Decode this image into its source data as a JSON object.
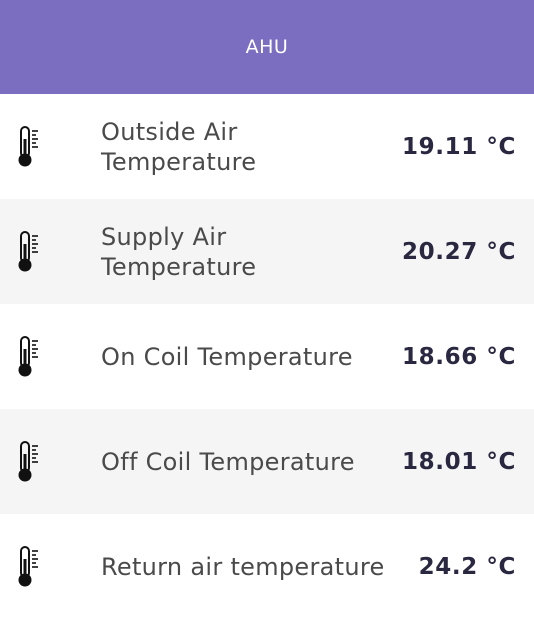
{
  "header": {
    "title": "AHU"
  },
  "sensors": [
    {
      "label": "Outside Air Temperature",
      "value": "19.11 °C",
      "icon": "thermometer-icon"
    },
    {
      "label": "Supply Air Temperature",
      "value": "20.27 °C",
      "icon": "thermometer-icon"
    },
    {
      "label": "On Coil Temperature",
      "value": "18.66 °C",
      "icon": "thermometer-icon"
    },
    {
      "label": "Off Coil Temperature",
      "value": "18.01 °C",
      "icon": "thermometer-icon"
    },
    {
      "label": "Return air temperature",
      "value": "24.2 °C",
      "icon": "thermometer-icon"
    }
  ],
  "colors": {
    "header_bg": "#7b6dc0",
    "alt_row_bg": "#f5f5f5",
    "value_text": "#2a2840",
    "label_text": "#4a4a4a"
  }
}
